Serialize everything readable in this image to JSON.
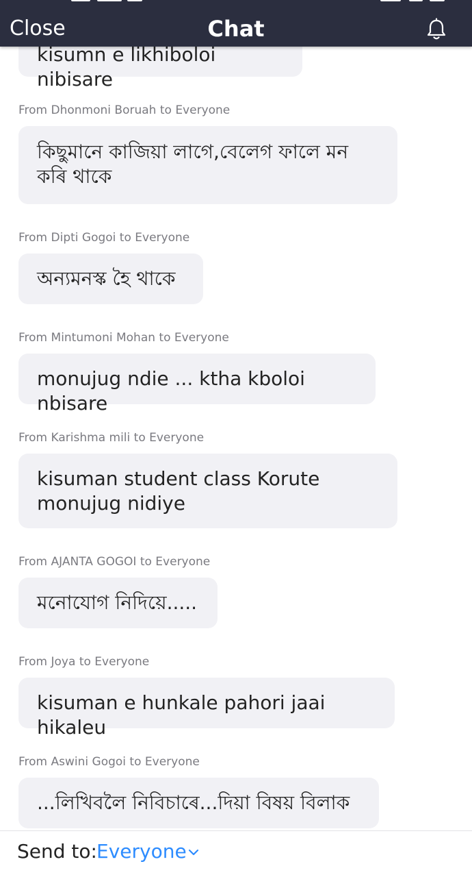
{
  "header": {
    "close_label": "Close",
    "title": "Chat",
    "bell_icon": "bell-icon"
  },
  "messages": [
    {
      "sender": "",
      "text": "kisumn e likhiboloi nibisare"
    },
    {
      "sender": "From Dhonmoni Boruah to Everyone",
      "text": "কিছুমানে কাজিয়া লাগে,বেলেগ ফালে মন কৰি থাকে"
    },
    {
      "sender": "From Dipti Gogoi to Everyone",
      "text": "অন্যমনস্ক হৈ থাকে"
    },
    {
      "sender": "From Mintumoni Mohan to Everyone",
      "text": "monujug ndie ... ktha kboloi nbisare"
    },
    {
      "sender": "From Karishma mili to Everyone",
      "text": "kisuman student class Korute monujug nidiye"
    },
    {
      "sender": "From AJANTA GOGOI to Everyone",
      "text": "মনোযোগ নিদিয়ে....."
    },
    {
      "sender": "From Joya to Everyone",
      "text": "kisuman e hunkale pahori jaai hikaleu"
    },
    {
      "sender": "From Aswini Gogoi to Everyone",
      "text": "...লিখিবলৈ নিবিচাৰে...দিয়া বিষয় বিলাক"
    }
  ],
  "footer": {
    "send_to_label": "Send to:",
    "recipient": "Everyone",
    "chevron_icon": "chevron-down-icon"
  },
  "colors": {
    "header_bg": "#2b2e3f",
    "bubble_bg": "#f1f1f5",
    "accent": "#2d8cff",
    "sender_text": "#7a7a80"
  }
}
